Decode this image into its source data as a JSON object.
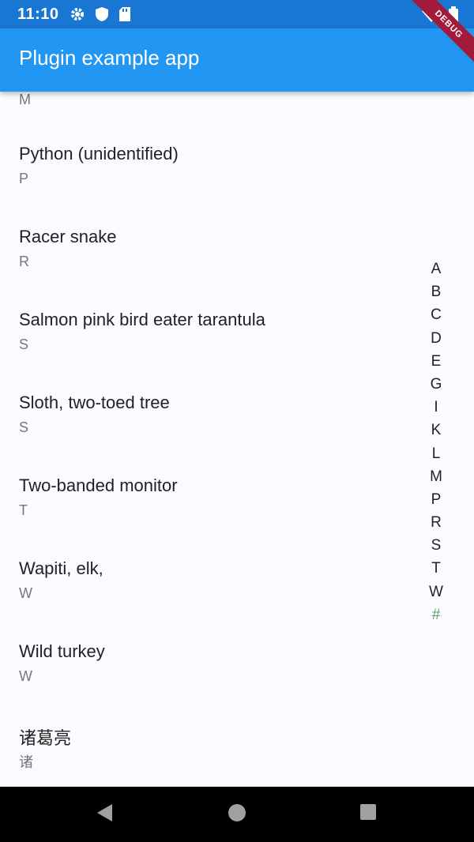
{
  "status_bar": {
    "time": "11:10",
    "icons_left": [
      "gear-icon",
      "shield-icon",
      "sd-card-icon"
    ],
    "icons_right": [
      "wifi-icon",
      "battery-icon"
    ]
  },
  "app_bar": {
    "title": "Plugin example app"
  },
  "debug_banner": "DEBUG",
  "list": {
    "partial_top_tag": "M",
    "items": [
      {
        "title": "Python (unidentified)",
        "tag": "P"
      },
      {
        "title": "Racer snake",
        "tag": "R"
      },
      {
        "title": "Salmon pink bird eater tarantula",
        "tag": "S"
      },
      {
        "title": "Sloth, two-toed tree",
        "tag": "S"
      },
      {
        "title": "Two-banded monitor",
        "tag": "T"
      },
      {
        "title": "Wapiti, elk,",
        "tag": "W"
      },
      {
        "title": "Wild turkey",
        "tag": "W"
      },
      {
        "title": "诸葛亮",
        "tag": "诸"
      }
    ]
  },
  "index_bar": {
    "letters": [
      "A",
      "B",
      "C",
      "D",
      "E",
      "G",
      "I",
      "K",
      "L",
      "M",
      "P",
      "R",
      "S",
      "T",
      "W",
      "#"
    ],
    "accent_color": "#5f9c6b"
  },
  "colors": {
    "status_bar": "#1976d2",
    "app_bar": "#2196f3",
    "background": "#fafbff",
    "nav_bar": "#000000"
  }
}
